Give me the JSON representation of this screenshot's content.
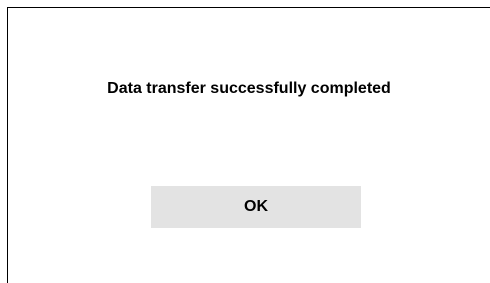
{
  "dialog": {
    "message": "Data transfer successfully completed",
    "ok_label": "OK"
  },
  "colors": {
    "background": "#ffffff",
    "border": "#000000",
    "button_background": "#e3e3e3",
    "text": "#000000"
  }
}
